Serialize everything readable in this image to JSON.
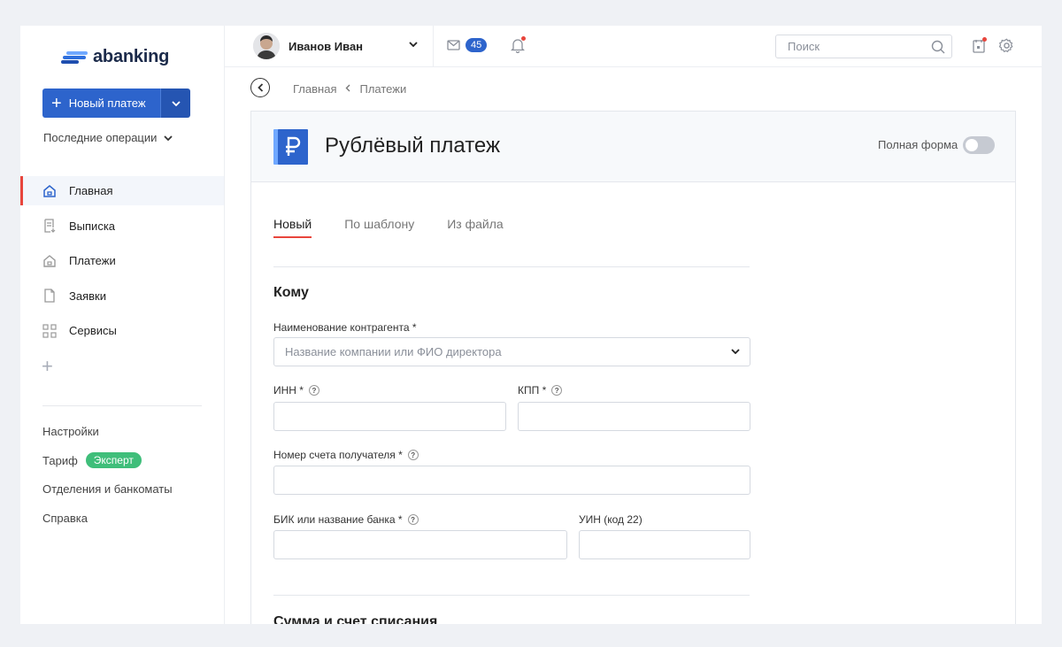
{
  "brand": {
    "logo_text": "abanking"
  },
  "sidebar": {
    "new_payment_label": "Новый платеж",
    "recent_label": "Последние операции",
    "nav": [
      {
        "label": "Главная",
        "icon": "home-icon",
        "active": true
      },
      {
        "label": "Выписка",
        "icon": "statement-icon",
        "active": false
      },
      {
        "label": "Платежи",
        "icon": "payments-icon",
        "active": false
      },
      {
        "label": "Заявки",
        "icon": "document-icon",
        "active": false
      },
      {
        "label": "Сервисы",
        "icon": "grid-icon",
        "active": false
      }
    ],
    "links": {
      "settings": "Настройки",
      "tariff": "Тариф",
      "tariff_badge": "Эксперт",
      "branches": "Отделения и банкоматы",
      "help": "Справка"
    }
  },
  "header": {
    "user_name": "Иванов Иван",
    "mail_count": "45",
    "search_placeholder": "Поиск"
  },
  "breadcrumb": {
    "home": "Главная",
    "current": "Платежи"
  },
  "card": {
    "title": "Рублёвый платеж",
    "full_form_label": "Полная форма",
    "tabs": [
      "Новый",
      "По шаблону",
      "Из файла"
    ],
    "section_to": "Кому",
    "section_amount": "Сумма и счет списания",
    "fields": {
      "counterparty_label": "Наименование контрагента *",
      "counterparty_placeholder": "Название компании или ФИО директора",
      "inn_label": "ИНН *",
      "kpp_label": "КПП *",
      "account_label": "Номер счета получателя *",
      "bik_label": "БИК или название банка *",
      "uin_label": "УИН (код 22)",
      "help_mark": "?"
    }
  },
  "colors": {
    "primary": "#2d64cc",
    "accent_red": "#e8453c",
    "badge_green": "#3fbe7a"
  }
}
